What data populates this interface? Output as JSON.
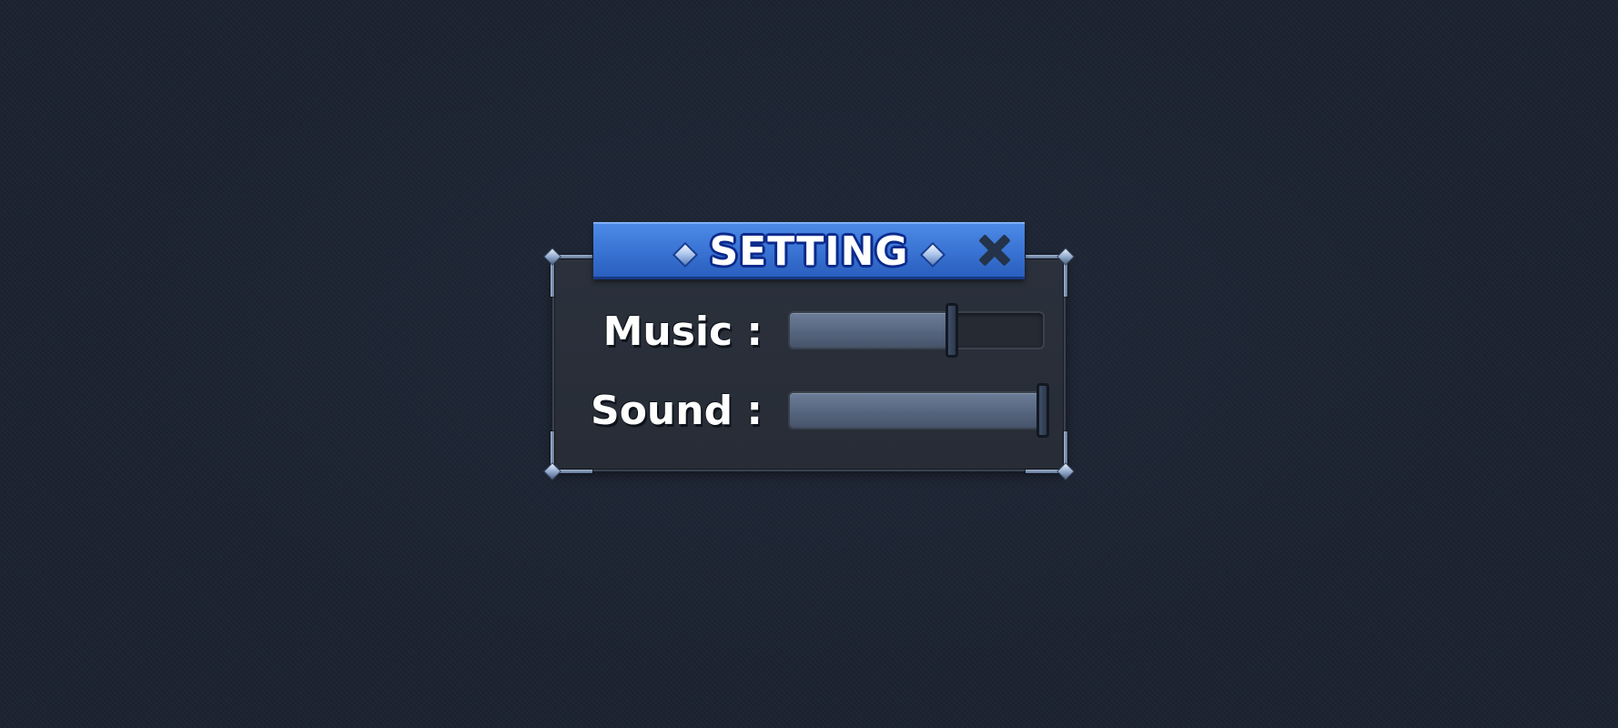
{
  "dialog": {
    "title": "SETTING",
    "close_icon": "close-x-icon",
    "accent_color": "#3a74d4",
    "title_outline_color": "#0b2a8c"
  },
  "settings": [
    {
      "id": "music",
      "label": "Music :",
      "level": 0.64
    },
    {
      "id": "sound",
      "label": "Sound :",
      "level": 1.0
    }
  ]
}
